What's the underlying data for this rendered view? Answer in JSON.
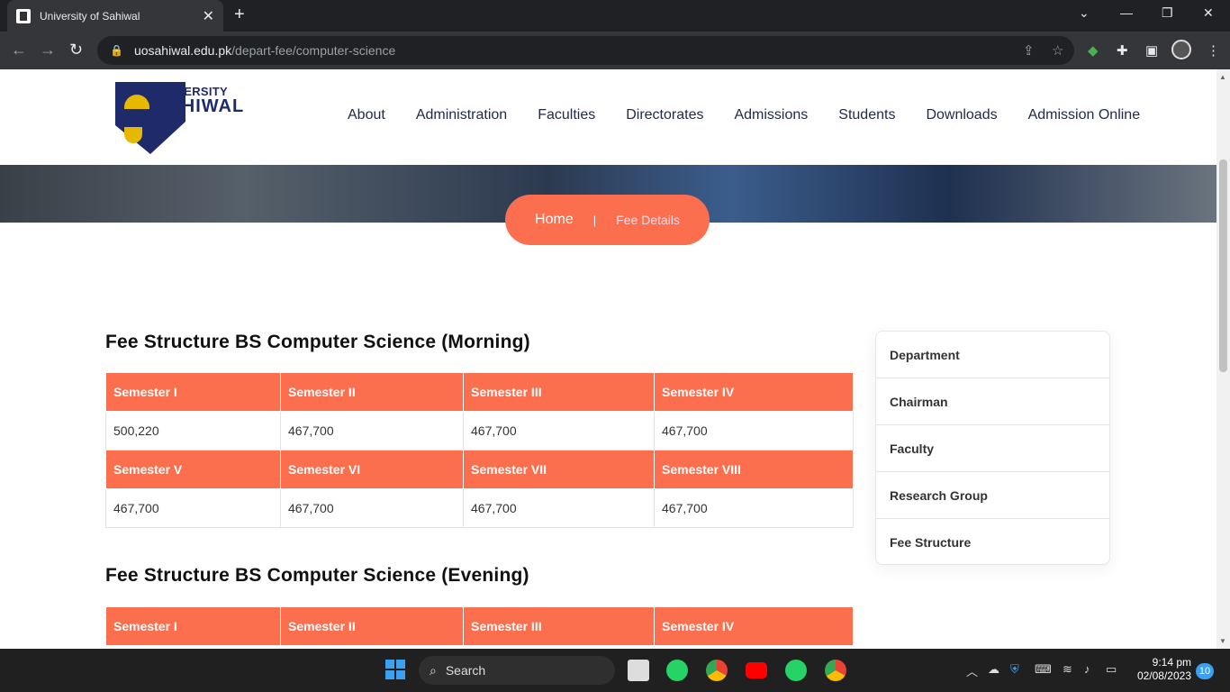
{
  "browser": {
    "tab_title": "University of Sahiwal",
    "url_host": "uosahiwal.edu.pk",
    "url_path": "/depart-fee/computer-science"
  },
  "site": {
    "logo_line1": "UNIVERSITY OF",
    "logo_line2": "SAHIWAL",
    "nav": [
      "About",
      "Administration",
      "Faculties",
      "Directorates",
      "Admissions",
      "Students",
      "Downloads",
      "Admission Online"
    ]
  },
  "breadcrumb": {
    "home": "Home",
    "separator": "|",
    "current": "Fee Details"
  },
  "morning": {
    "title": "Fee Structure BS Computer Science (Morning)",
    "rows": [
      {
        "headers": [
          "Semester I",
          "Semester II",
          "Semester III",
          "Semester IV"
        ],
        "values": [
          "500,220",
          "467,700",
          "467,700",
          "467,700"
        ]
      },
      {
        "headers": [
          "Semester V",
          "Semester VI",
          "Semester VII",
          "Semester VIII"
        ],
        "values": [
          "467,700",
          "467,700",
          "467,700",
          "467,700"
        ]
      }
    ]
  },
  "evening": {
    "title": "Fee Structure BS Computer Science (Evening)",
    "headers": [
      "Semester I",
      "Semester II",
      "Semester III",
      "Semester IV"
    ]
  },
  "sidebar": [
    "Department",
    "Chairman",
    "Faculty",
    "Research Group",
    "Fee Structure"
  ],
  "taskbar": {
    "search_label": "Search",
    "time": "9:14 pm",
    "date": "02/08/2023",
    "notifications": "10"
  },
  "colors": {
    "accent": "#fb6e4e",
    "navy": "#1f2a6b"
  }
}
